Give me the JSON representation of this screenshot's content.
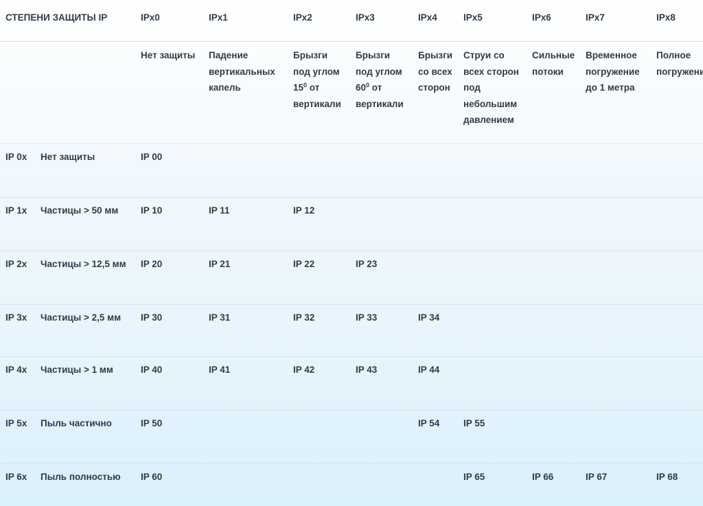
{
  "table": {
    "corner_title": "СТЕПЕНИ ЗАЩИТЫ IP",
    "columns": [
      {
        "code": "IPx0",
        "desc": "Нет защиты"
      },
      {
        "code": "IPx1",
        "desc": "Падение\nвертикальных\nкапель"
      },
      {
        "code": "IPx2",
        "desc_parts": [
          "Брызги\nпод углом\n15",
          "0",
          " от\nвертикали"
        ]
      },
      {
        "code": "IPx3",
        "desc_parts": [
          "Брызги\nпод углом\n60",
          "0",
          " от\nвертикали"
        ]
      },
      {
        "code": "IPx4",
        "desc": "Брызги\nсо всех\nсторон"
      },
      {
        "code": "IPx5",
        "desc": "Струи со\nвсех сторон\nпод\nнебольшим\nдавлением"
      },
      {
        "code": "IPx6",
        "desc": "Сильные\nпотоки"
      },
      {
        "code": "IPx7",
        "desc": "Временное\nпогружение\nдо 1 метра"
      },
      {
        "code": "IPx8",
        "desc": "Полное\nпогружение"
      }
    ],
    "rows": [
      {
        "code": "IP 0x",
        "label": "Нет защиты",
        "cells": [
          "IP 00",
          "",
          "",
          "",
          "",
          "",
          "",
          "",
          ""
        ]
      },
      {
        "code": "IP 1x",
        "label": "Частицы > 50 мм",
        "cells": [
          "IP 10",
          "IP 11",
          "IP 12",
          "",
          "",
          "",
          "",
          "",
          ""
        ]
      },
      {
        "code": "IP 2x",
        "label": "Частицы > 12,5 мм",
        "cells": [
          "IP 20",
          "IP 21",
          "IP 22",
          "IP 23",
          "",
          "",
          "",
          "",
          ""
        ]
      },
      {
        "code": "IP 3x",
        "label": "Частицы > 2,5 мм",
        "cells": [
          "IP 30",
          "IP 31",
          "IP 32",
          "IP 33",
          "IP 34",
          "",
          "",
          "",
          ""
        ]
      },
      {
        "code": "IP 4x",
        "label": "Частицы > 1 мм",
        "cells": [
          "IP 40",
          "IP 41",
          "IP 42",
          "IP 43",
          "IP 44",
          "",
          "",
          "",
          ""
        ]
      },
      {
        "code": "IP 5x",
        "label": "Пыль частично",
        "cells": [
          "IP 50",
          "",
          "",
          "",
          "IP 54",
          "IP 55",
          "",
          "",
          ""
        ]
      },
      {
        "code": "IP 6x",
        "label": "Пыль полностью",
        "cells": [
          "IP 60",
          "",
          "",
          "",
          "",
          "IP 65",
          "IP 66",
          "IP 67",
          "IP 68"
        ]
      }
    ]
  }
}
